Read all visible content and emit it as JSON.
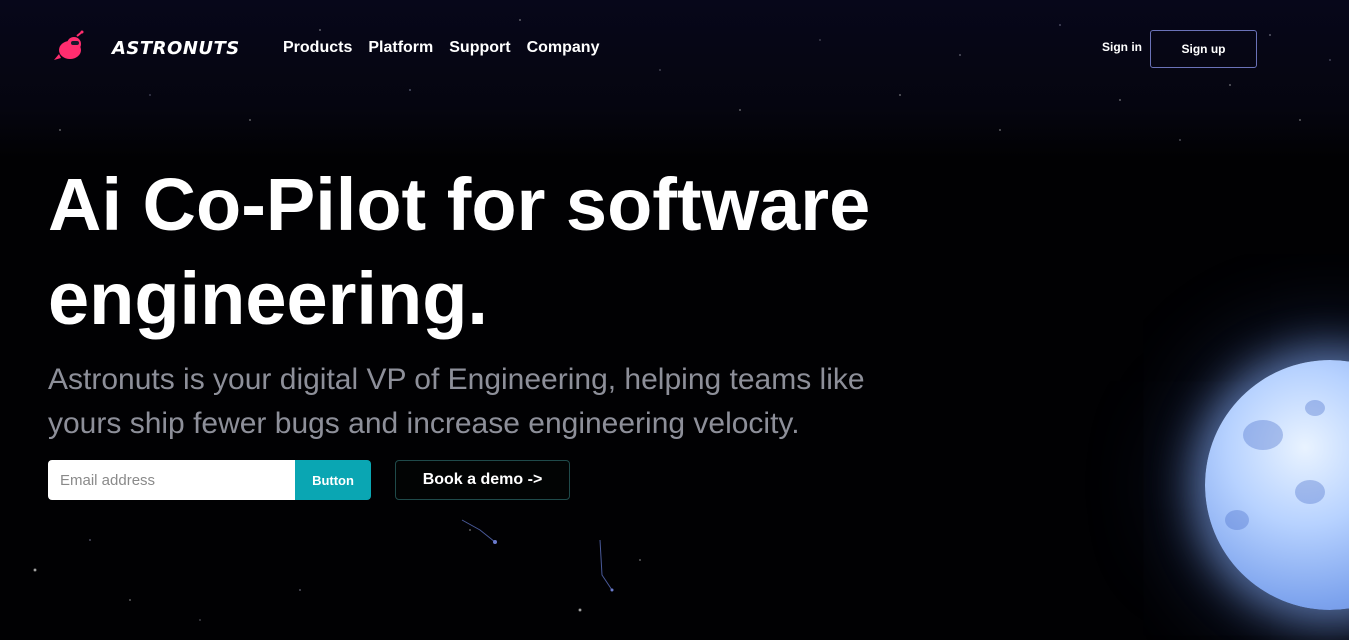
{
  "brand": {
    "name": "ASTRONUTS"
  },
  "nav": {
    "items": [
      "Products",
      "Platform",
      "Support",
      "Company"
    ]
  },
  "auth": {
    "signin": "Sign in",
    "signup": "Sign up"
  },
  "hero": {
    "title": "Ai Co-Pilot for software engineering.",
    "subtitle": "Astronuts is your digital VP of Engineering, helping teams like yours ship fewer bugs and increase engineering velocity."
  },
  "signup_form": {
    "email_placeholder": "Email address",
    "button_label": "Button"
  },
  "demo": {
    "label": "Book a demo ->"
  },
  "colors": {
    "accent": "#0aa6b3",
    "brand_pink": "#ff2d6f",
    "background": "#010103"
  }
}
